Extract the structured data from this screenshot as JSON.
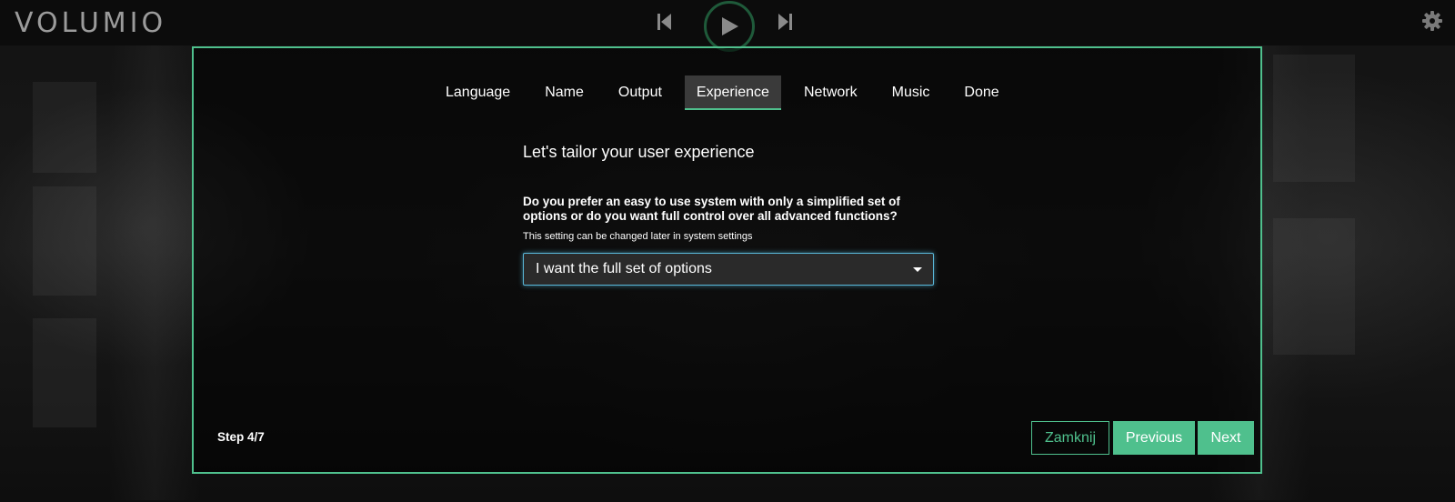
{
  "app": {
    "logo": "VOLUMIO"
  },
  "player": {
    "prev_icon": "skip-previous-icon",
    "play_icon": "play-icon",
    "next_icon": "skip-next-icon"
  },
  "settings": {
    "icon": "gear-icon"
  },
  "wizard": {
    "tabs": [
      {
        "label": "Language",
        "active": false
      },
      {
        "label": "Name",
        "active": false
      },
      {
        "label": "Output",
        "active": false
      },
      {
        "label": "Experience",
        "active": true
      },
      {
        "label": "Network",
        "active": false
      },
      {
        "label": "Music",
        "active": false
      },
      {
        "label": "Done",
        "active": false
      }
    ],
    "heading": "Let's tailor your user experience",
    "question": "Do you prefer an easy to use system with only a simplified set of options or do you want full control over all advanced functions?",
    "hint": "This setting can be changed later in system settings",
    "select_value": "I want the full set of options",
    "step": "Step 4/7",
    "buttons": {
      "close": "Zamknij",
      "previous": "Previous",
      "next": "Next"
    }
  },
  "colors": {
    "accent": "#4fc08d",
    "focus": "#59b7d8",
    "background": "#0b0b0b"
  }
}
